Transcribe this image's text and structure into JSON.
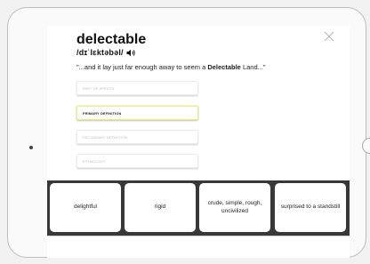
{
  "card": {
    "word": "delectable",
    "pronunciation": "/dɪˈlɛktəbəl/",
    "example_before": "\"...and it lay just far enough away to seem a ",
    "example_highlight": "Delectable",
    "example_after": " Land...\""
  },
  "fields": [
    {
      "label": "PART OF SPEECH",
      "state": "inactive"
    },
    {
      "label": "PRIMARY DEFINITION",
      "state": "active"
    },
    {
      "label": "SECONDARY DEFINITION",
      "state": "inactive"
    },
    {
      "label": "ETYMOLOGY",
      "state": "inactive"
    }
  ],
  "choices": [
    {
      "label": "delightful"
    },
    {
      "label": "rigid"
    },
    {
      "label": "crude, simple, rough, uncivilized"
    },
    {
      "label": "surprised to a standstill"
    }
  ],
  "icons": {
    "close": "close-icon",
    "speaker": "speaker-icon"
  },
  "colors": {
    "tray": "#383838",
    "active_field_border": "#e9eb9a"
  }
}
